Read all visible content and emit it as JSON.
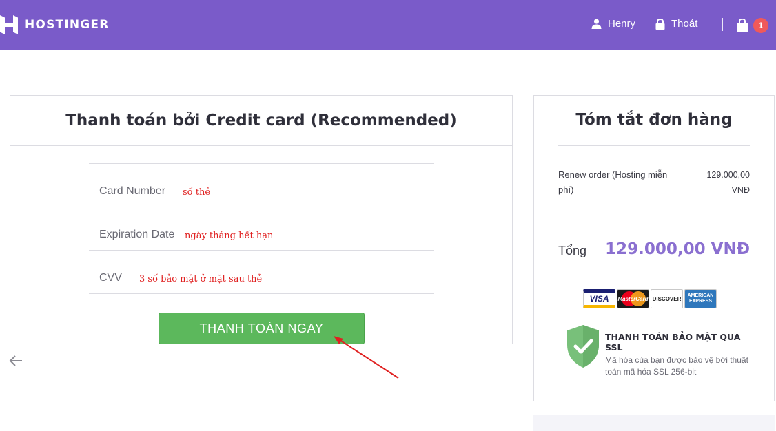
{
  "header": {
    "brand": "HOSTINGER",
    "user_name": "Henry",
    "logout_label": "Thoát",
    "cart_count": "1"
  },
  "payment": {
    "title": "Thanh toán bởi Credit card (Recommended)",
    "fields": [
      {
        "label": "Card Number",
        "note": "số thẻ"
      },
      {
        "label": "Expiration Date",
        "note": "ngày tháng hết hạn"
      },
      {
        "label": "CVV",
        "note": "3 số bảo mật ở mặt sau thẻ"
      }
    ],
    "submit_label": "THANH TOÁN NGAY"
  },
  "summary": {
    "title": "Tóm tắt đơn hàng",
    "order_item": "Renew order (Hosting miễn phí)",
    "order_price": "129.000,00 VNĐ",
    "total_label": "Tổng",
    "total_value": "129.000,00 VNĐ",
    "card_brands": [
      "VISA",
      "MasterCard",
      "DISCOVER",
      "AMERICAN EXPRESS"
    ],
    "ssl_title": "THANH TOÁN BẢO MẬT QUA SSL",
    "ssl_desc": "Mã hóa của bạn được bảo vệ bởi thuật toán mã hóa SSL 256-bit"
  },
  "colors": {
    "header_bg": "#7a5bc9",
    "button_green": "#5cb85c",
    "total_purple": "#8a6fd0",
    "annotation_red": "#e02020",
    "badge_red": "#f0595a"
  }
}
